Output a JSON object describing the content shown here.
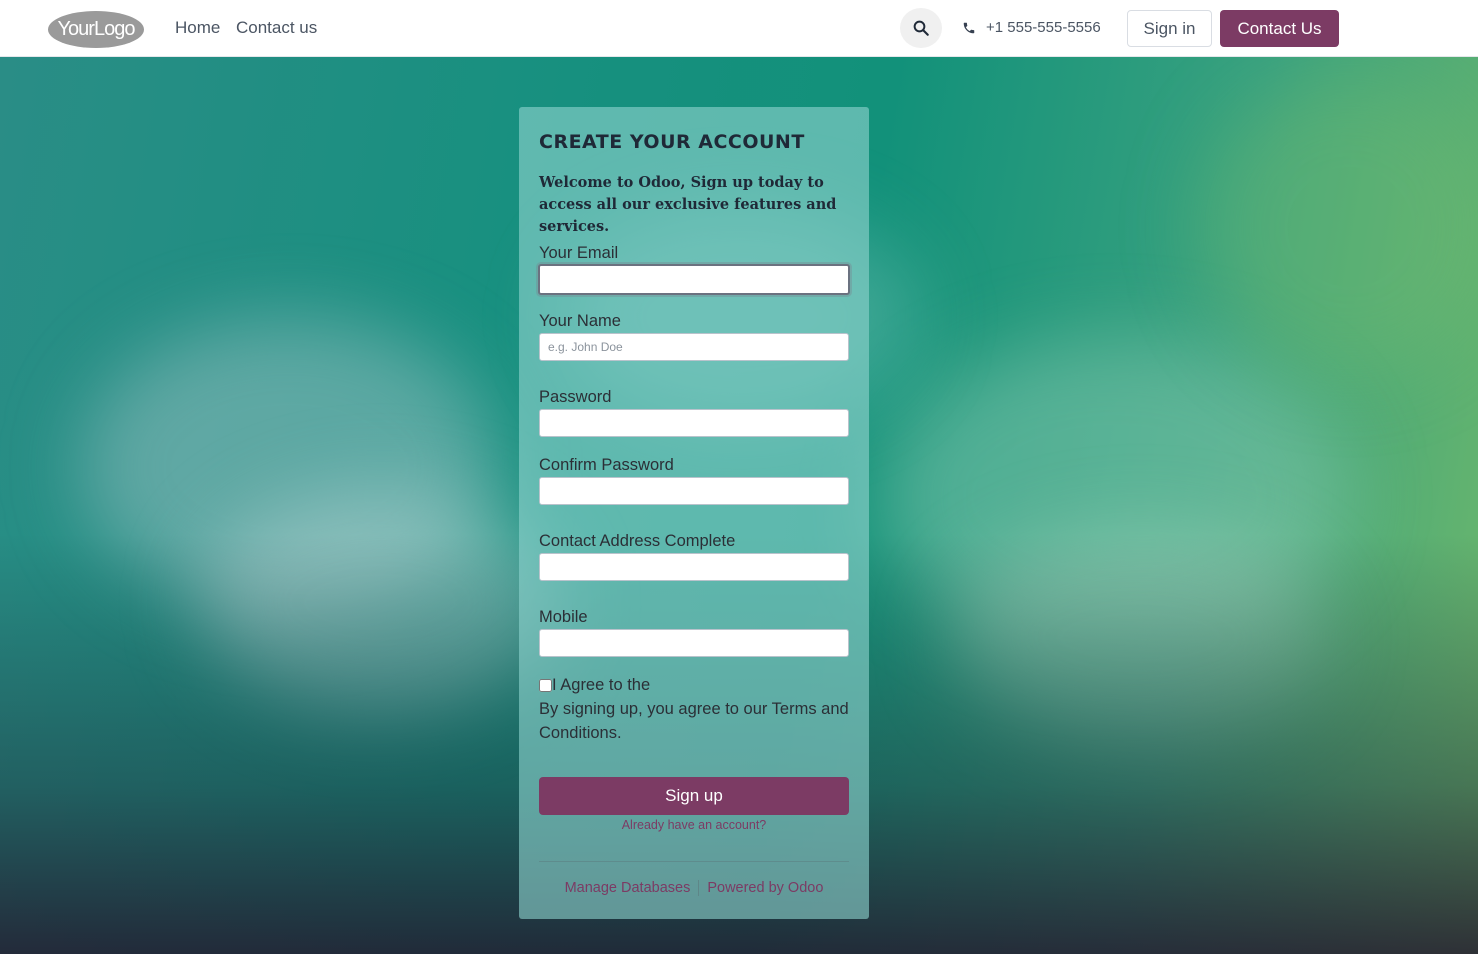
{
  "header": {
    "logo": "YourLogo",
    "nav": [
      "Home",
      "Contact us"
    ],
    "phone": "+1 555-555-5556",
    "signin_label": "Sign in",
    "contact_label": "Contact Us"
  },
  "form": {
    "title": "CREATE YOUR ACCOUNT",
    "welcome": "Welcome to Odoo,  Sign up today to access all our exclusive features and services.",
    "fields": {
      "email": {
        "label": "Your Email",
        "value": "",
        "placeholder": ""
      },
      "name": {
        "label": "Your Name",
        "value": "",
        "placeholder": "e.g. John Doe"
      },
      "password": {
        "label": "Password",
        "value": ""
      },
      "confirm_password": {
        "label": "Confirm Password",
        "value": ""
      },
      "address": {
        "label": "Contact Address Complete",
        "value": ""
      },
      "mobile": {
        "label": "Mobile",
        "value": ""
      }
    },
    "agree_label": "I Agree to the",
    "agree_checked": false,
    "terms_text": "By signing up, you agree to our Terms and Conditions.",
    "signup_label": "Sign up",
    "already_account": "Already have an account?",
    "footer": {
      "manage_db": "Manage Databases",
      "powered_by": "Powered by Odoo"
    }
  },
  "colors": {
    "brand": "#7c3b64",
    "header_bg": "#ffffff",
    "card_bg": "rgba(140,210,205,0.62)"
  }
}
